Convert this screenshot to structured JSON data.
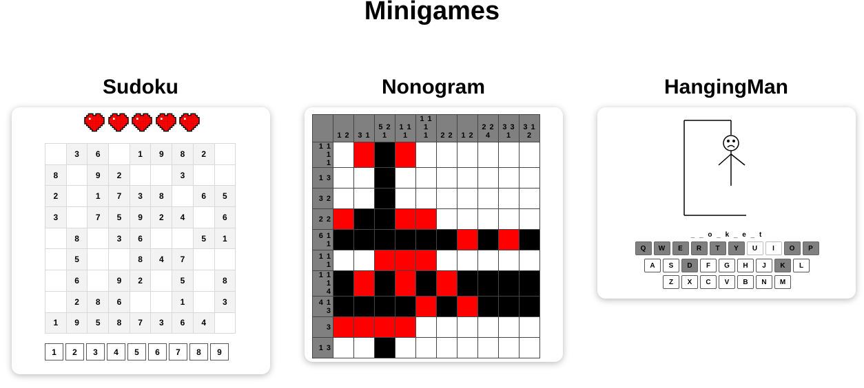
{
  "page": {
    "title": "Minigames"
  },
  "sudoku": {
    "title": "Sudoku",
    "lives": 5,
    "heart_icon": "pixel-heart-icon",
    "heart_color": "#ff0000",
    "grid": [
      [
        "",
        "3",
        "6",
        "",
        "1",
        "9",
        "8",
        "2",
        ""
      ],
      [
        "8",
        "",
        "9",
        "2",
        "",
        "",
        "3",
        "",
        ""
      ],
      [
        "2",
        "",
        "1",
        "7",
        "3",
        "8",
        "",
        "6",
        "5"
      ],
      [
        "3",
        "",
        "7",
        "5",
        "9",
        "2",
        "4",
        "",
        "6"
      ],
      [
        "",
        "8",
        "",
        "3",
        "6",
        "",
        "",
        "5",
        "1"
      ],
      [
        "",
        "5",
        "",
        "",
        "8",
        "4",
        "7",
        "",
        ""
      ],
      [
        "",
        "6",
        "",
        "9",
        "2",
        "",
        "5",
        "",
        "8"
      ],
      [
        "",
        "2",
        "8",
        "6",
        "",
        "",
        "1",
        "",
        "3"
      ],
      [
        "1",
        "9",
        "5",
        "8",
        "7",
        "3",
        "6",
        "4",
        ""
      ]
    ],
    "numpad": [
      "1",
      "2",
      "3",
      "4",
      "5",
      "6",
      "7",
      "8",
      "9"
    ]
  },
  "nonogram": {
    "title": "Nonogram",
    "colors": {
      "empty": "#ffffff",
      "filled": "#000000",
      "marked": "#ff0000",
      "clue_bg": "#808080"
    },
    "col_clues": [
      "1 2",
      "3 1",
      "5 2 1",
      "1 1 1",
      "1 1 1\n1",
      "2 2",
      "1 2",
      "2 2 4",
      "3 3 1",
      "3 1 2"
    ],
    "row_clues": [
      "1 1 1\n1",
      "1 3",
      "3 2",
      "2 2",
      "6 1 1",
      "1 1 1",
      "1 1 1\n4",
      "4 1 3",
      "3",
      "1 3"
    ],
    "cells": [
      [
        0,
        2,
        1,
        2,
        0,
        0,
        0,
        0,
        0,
        0
      ],
      [
        0,
        0,
        1,
        0,
        0,
        0,
        0,
        0,
        0,
        0
      ],
      [
        0,
        0,
        1,
        0,
        0,
        0,
        0,
        0,
        0,
        0
      ],
      [
        2,
        1,
        1,
        2,
        2,
        0,
        0,
        0,
        0,
        0
      ],
      [
        1,
        1,
        1,
        1,
        1,
        1,
        2,
        1,
        2,
        1
      ],
      [
        0,
        0,
        2,
        2,
        2,
        0,
        0,
        0,
        0,
        0
      ],
      [
        1,
        2,
        1,
        2,
        1,
        2,
        1,
        1,
        1,
        1
      ],
      [
        1,
        1,
        1,
        1,
        2,
        1,
        2,
        1,
        1,
        1
      ],
      [
        2,
        2,
        2,
        2,
        0,
        0,
        0,
        0,
        0,
        0
      ],
      [
        0,
        0,
        1,
        0,
        0,
        0,
        0,
        0,
        0,
        0
      ]
    ]
  },
  "hangman": {
    "title": "HangingMan",
    "word": "_ _ o _ k _ e _ t",
    "face_icon": "sad-face-icon",
    "keyboard": {
      "row1": [
        {
          "k": "Q",
          "state": "used"
        },
        {
          "k": "W",
          "state": "used"
        },
        {
          "k": "E",
          "state": "used"
        },
        {
          "k": "R",
          "state": "used"
        },
        {
          "k": "T",
          "state": "used"
        },
        {
          "k": "Y",
          "state": "used"
        },
        {
          "k": "U",
          "state": "ok"
        },
        {
          "k": "I",
          "state": "ok"
        },
        {
          "k": "O",
          "state": "used"
        },
        {
          "k": "P",
          "state": "used"
        }
      ],
      "row2": [
        {
          "k": "A",
          "state": ""
        },
        {
          "k": "S",
          "state": ""
        },
        {
          "k": "D",
          "state": "used"
        },
        {
          "k": "F",
          "state": ""
        },
        {
          "k": "G",
          "state": ""
        },
        {
          "k": "H",
          "state": ""
        },
        {
          "k": "J",
          "state": ""
        },
        {
          "k": "K",
          "state": "used"
        },
        {
          "k": "L",
          "state": ""
        }
      ],
      "row3": [
        {
          "k": "Z",
          "state": ""
        },
        {
          "k": "X",
          "state": ""
        },
        {
          "k": "C",
          "state": ""
        },
        {
          "k": "V",
          "state": ""
        },
        {
          "k": "B",
          "state": ""
        },
        {
          "k": "N",
          "state": ""
        },
        {
          "k": "M",
          "state": ""
        }
      ]
    }
  }
}
